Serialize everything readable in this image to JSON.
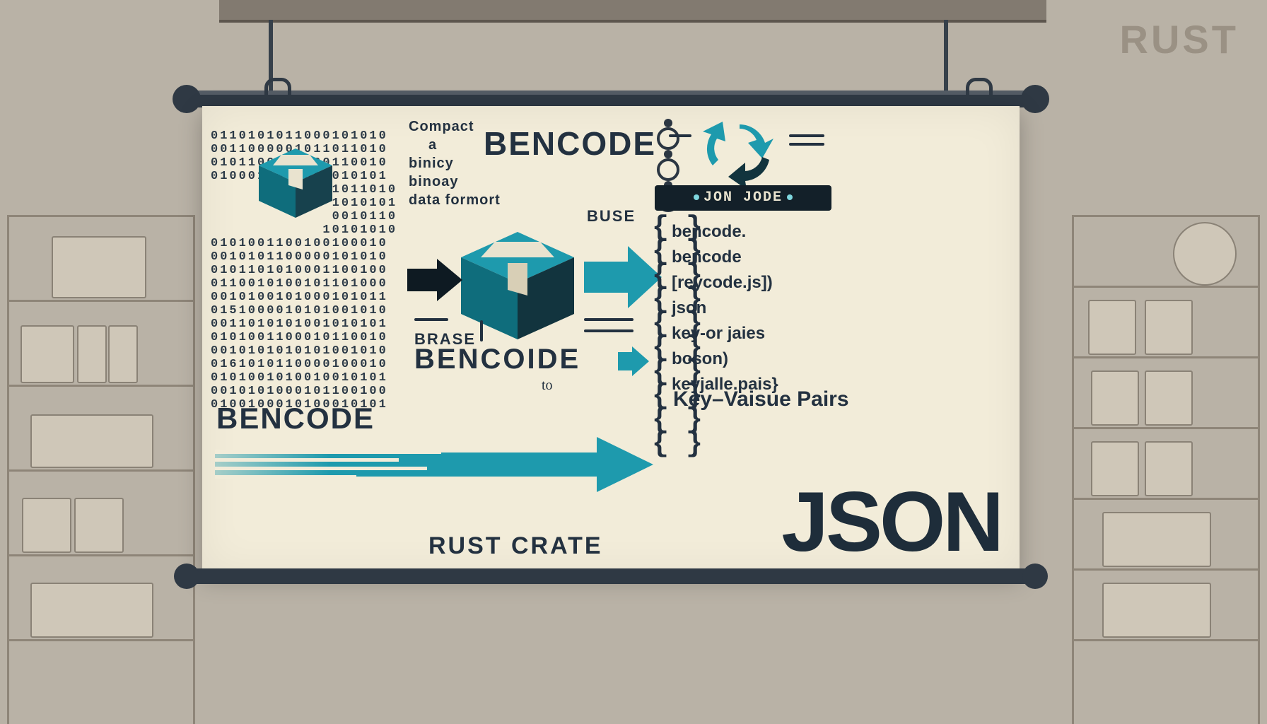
{
  "corner_label": "RUST",
  "binary_rows": [
    "0110101011000101010",
    "0011000001011011010",
    "0101100111000110010",
    "0100011000011010101",
    "             1011010",
    "             1010101",
    "             0010110",
    "            10101010",
    "0101001100100100010",
    "0010101100000101010",
    "0101101010001100100",
    "0110010100101101000",
    "0010100101000101011",
    "0151000010101001010",
    "0011010101001010101",
    "0101001100010110010",
    "0010101010101001010",
    "0161010110000100010",
    "0101001010010010101",
    "0010101000101100100",
    "0100100010100010101"
  ],
  "labels": {
    "compact1": "Compact",
    "compact2": "a",
    "compact3": "binicy",
    "compact4": "binoay",
    "compact5": "data formort",
    "bencode_title": "BENCODE",
    "brase": "BRASE",
    "bencoide": "BENCOIDE",
    "to": "to",
    "buse": "BUSE",
    "bencode_small": "BENCODE",
    "rust_crate": "RUST CRATE",
    "kvp": "Key–Vaisue Pairs",
    "plaque": "JON  JODE",
    "json_big": "JSON"
  },
  "key_list": [
    "bencode.",
    "bencode",
    "[reycode.js])",
    "json",
    "key-or jaies",
    "boson)",
    "keyjalle.pais}"
  ],
  "colors": {
    "teal": "#1e9aad",
    "teal_dark": "#0f6d7c",
    "ink": "#233140"
  }
}
